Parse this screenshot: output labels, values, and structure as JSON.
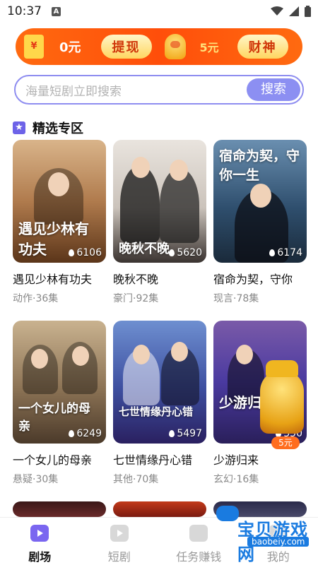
{
  "status_bar": {
    "time": "10:37",
    "notification_glyph": "A"
  },
  "banner": {
    "balance": "0元",
    "withdraw_label": "提现",
    "reward": "5元",
    "god_label": "财神"
  },
  "search": {
    "placeholder": "海量短剧立即搜索",
    "button": "搜索"
  },
  "section": {
    "title": "精选专区"
  },
  "dramas": [
    {
      "name": "遇见少林有功夫",
      "meta": "动作·36集",
      "views": "6106",
      "poster_text": "遇见少林有功夫"
    },
    {
      "name": "晚秋不晚",
      "meta": "豪门·92集",
      "views": "5620",
      "poster_text": "晚秋不晚"
    },
    {
      "name": "宿命为契，守你",
      "meta": "现言·78集",
      "views": "6174",
      "poster_text": "宿命为契，守你一生"
    },
    {
      "name": "一个女儿的母亲",
      "meta": "悬疑·30集",
      "views": "6249",
      "poster_text": "一个女儿的母亲"
    },
    {
      "name": "七世情缘丹心错",
      "meta": "其他·70集",
      "views": "5497",
      "poster_text": "七世情缘丹心错"
    },
    {
      "name": "少游归来",
      "meta": "玄幻·16集",
      "views": "350",
      "poster_text": "少游归来"
    }
  ],
  "floating_reward": {
    "amount": "5元"
  },
  "bottom_nav": [
    {
      "label": "剧场",
      "icon": "drama-icon",
      "active": true
    },
    {
      "label": "短剧",
      "icon": "short-video-icon",
      "active": false
    },
    {
      "label": "任务赚钱",
      "icon": "task-icon",
      "active": false
    },
    {
      "label": "我的",
      "icon": "profile-icon",
      "active": false
    }
  ],
  "watermark": {
    "text": "宝贝游戏网",
    "url": "baobeiy.com"
  },
  "colors": {
    "accent": "#8c8ff2",
    "banner": "#ff5a0c",
    "active_tab": "#7a66f0"
  }
}
